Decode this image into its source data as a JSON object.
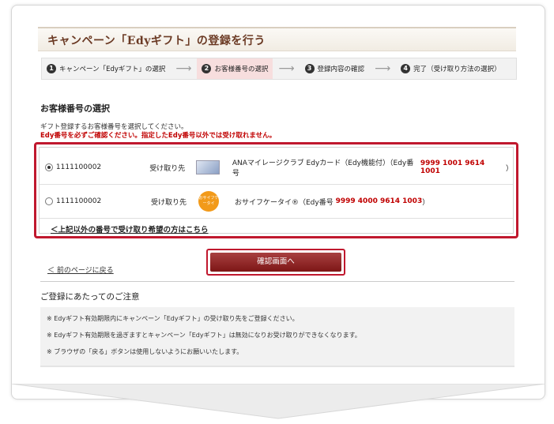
{
  "page": {
    "title": "キャンペーン「Edyギフト」の登録を行う"
  },
  "steps": [
    {
      "num": "1",
      "label": "キャンペーン「Edyギフト」の選択"
    },
    {
      "num": "2",
      "label": "お客様番号の選択"
    },
    {
      "num": "3",
      "label": "登録内容の確認"
    },
    {
      "num": "4",
      "label": "完了（受け取り方法の選択）"
    }
  ],
  "arrow": "⟶",
  "section": {
    "heading": "お客様番号の選択",
    "description": "ギフト登録するお客様番号を選択してください。",
    "warning": "Edy番号を必ずご確認ください。指定したEdy番号以外では受け取れません。"
  },
  "options": [
    {
      "account": "1111100002",
      "recipient_label": "受け取り先",
      "icon": "card-icon",
      "name": "ANAマイレージクラブ Edyカード（Edy機能付）（Edy番号",
      "edy_number": "9999 1001 9614 1001",
      "suffix": "）",
      "selected": true
    },
    {
      "account": "1111100002",
      "recipient_label": "受け取り先",
      "icon": "osaifu-keitai-icon",
      "icon_text": "おサイフケータイ",
      "name": "おサイフケータイ®（Edy番号",
      "edy_number": "9999 4000 9614 1003",
      "suffix": "）",
      "selected": false
    }
  ],
  "other_link": "＜上記以外の番号で受け取り希望の方はこちら",
  "confirm_button": "確認画面へ",
  "back_link": "＜ 前のページに戻る",
  "notes": {
    "heading": "ご登録にあたってのご注意",
    "items": [
      "※ Edyギフト有効期限内にキャンペーン「Edyギフト」の受け取り先をご登録ください。",
      "※ Edyギフト有効期限を過ぎますとキャンペーン「Edyギフト」は無効になりお受け取りができなくなります。",
      "※ ブラウザの「戻る」ボタンは使用しないようにお願いいたします。"
    ]
  }
}
